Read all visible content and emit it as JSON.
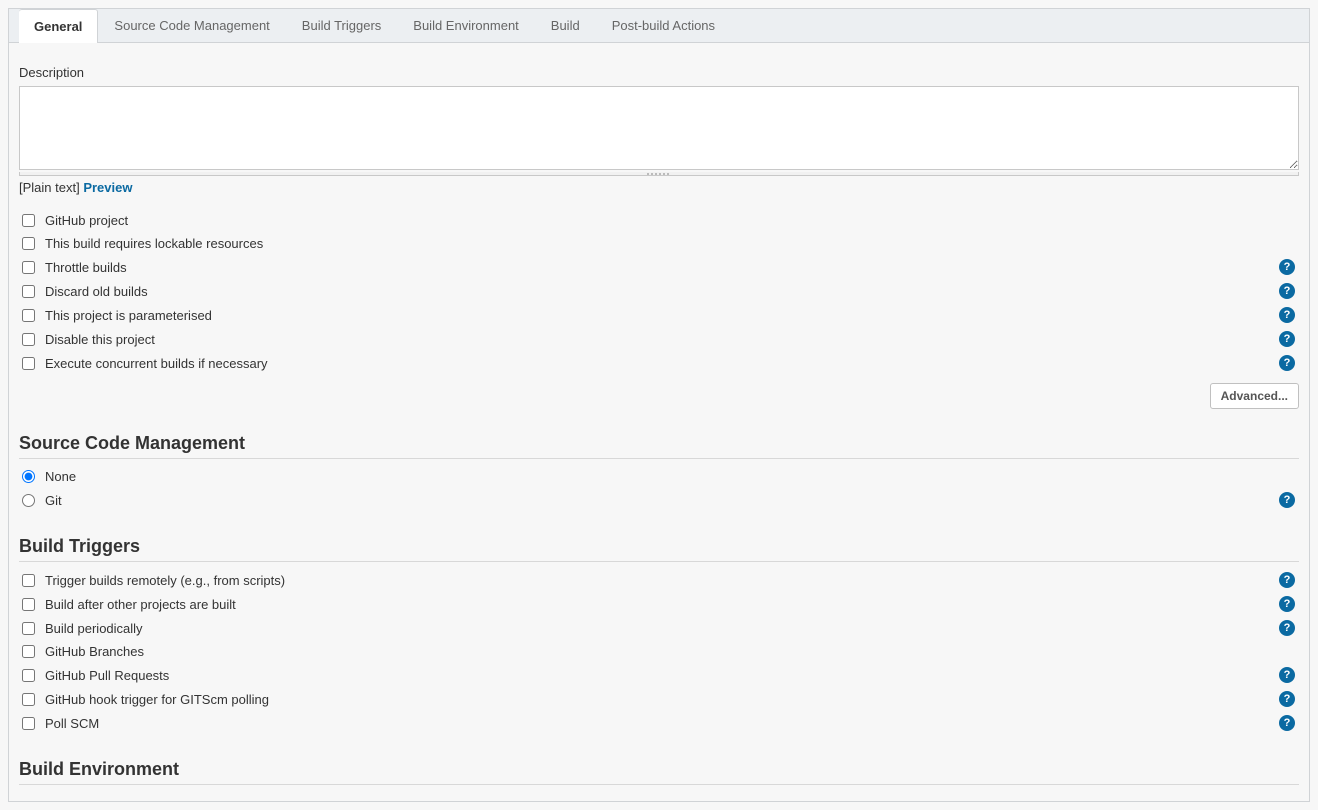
{
  "tabs": [
    {
      "label": "General",
      "active": true
    },
    {
      "label": "Source Code Management",
      "active": false
    },
    {
      "label": "Build Triggers",
      "active": false
    },
    {
      "label": "Build Environment",
      "active": false
    },
    {
      "label": "Build",
      "active": false
    },
    {
      "label": "Post-build Actions",
      "active": false
    }
  ],
  "description": {
    "label": "Description",
    "value": "",
    "plain_text_label": "[Plain text]",
    "preview_label": "Preview"
  },
  "general_options": [
    {
      "label": "GitHub project",
      "checked": false,
      "help": false
    },
    {
      "label": "This build requires lockable resources",
      "checked": false,
      "help": false
    },
    {
      "label": "Throttle builds",
      "checked": false,
      "help": true
    },
    {
      "label": "Discard old builds",
      "checked": false,
      "help": true
    },
    {
      "label": "This project is parameterised",
      "checked": false,
      "help": true
    },
    {
      "label": "Disable this project",
      "checked": false,
      "help": true
    },
    {
      "label": "Execute concurrent builds if necessary",
      "checked": false,
      "help": true
    }
  ],
  "advanced_label": "Advanced...",
  "scm": {
    "heading": "Source Code Management",
    "options": [
      {
        "label": "None",
        "checked": true,
        "help": false
      },
      {
        "label": "Git",
        "checked": false,
        "help": true
      }
    ]
  },
  "triggers": {
    "heading": "Build Triggers",
    "options": [
      {
        "label": "Trigger builds remotely (e.g., from scripts)",
        "checked": false,
        "help": true
      },
      {
        "label": "Build after other projects are built",
        "checked": false,
        "help": true
      },
      {
        "label": "Build periodically",
        "checked": false,
        "help": true
      },
      {
        "label": "GitHub Branches",
        "checked": false,
        "help": false
      },
      {
        "label": "GitHub Pull Requests",
        "checked": false,
        "help": true
      },
      {
        "label": "GitHub hook trigger for GITScm polling",
        "checked": false,
        "help": true
      },
      {
        "label": "Poll SCM",
        "checked": false,
        "help": true
      }
    ]
  },
  "build_env": {
    "heading": "Build Environment"
  }
}
